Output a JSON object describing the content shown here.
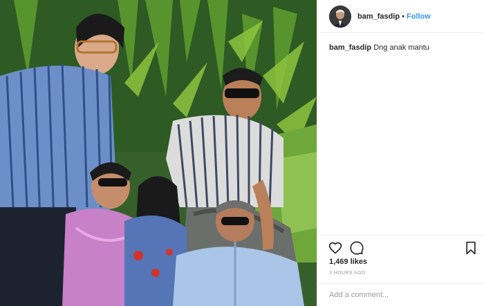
{
  "post": {
    "username": "bam_fasdip",
    "separator": "•",
    "follow_label": "Follow",
    "caption_user": "bam_fasdip",
    "caption_text": "Dng anak mantu",
    "likes": "1,469 likes",
    "time": "3 HOURS AGO",
    "comment_placeholder": "Add a comment..."
  },
  "icons": {
    "like": "heart-outline-icon",
    "comment": "speech-bubble-icon",
    "save": "bookmark-outline-icon"
  },
  "colors": {
    "follow": "#3897f0",
    "text": "#262626",
    "muted": "#999999",
    "border": "#efefef"
  }
}
